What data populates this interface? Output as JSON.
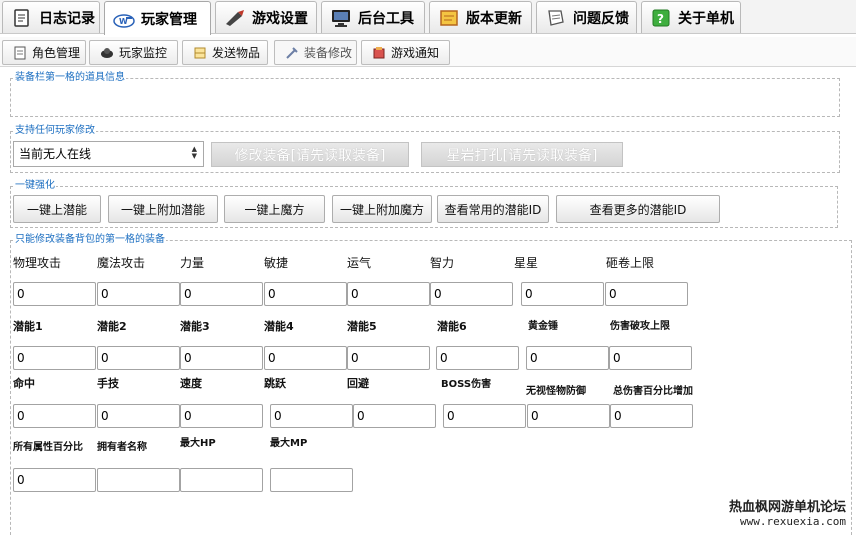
{
  "main_tabs": [
    {
      "label": "日志记录",
      "icon": "journal-icon"
    },
    {
      "label": "玩家管理",
      "icon": "user-manage-icon"
    },
    {
      "label": "游戏设置",
      "icon": "game-settings-icon"
    },
    {
      "label": "后台工具",
      "icon": "monitor-icon"
    },
    {
      "label": "版本更新",
      "icon": "scroll-icon"
    },
    {
      "label": "问题反馈",
      "icon": "feedback-icon"
    },
    {
      "label": "关于单机",
      "icon": "help-icon"
    }
  ],
  "sub_tabs": [
    {
      "label": "角色管理",
      "icon": "character-icon"
    },
    {
      "label": "玩家监控",
      "icon": "monitor-icon"
    },
    {
      "label": "发送物品",
      "icon": "send-item-icon"
    },
    {
      "label": "装备修改",
      "icon": "equipment-icon"
    },
    {
      "label": "游戏通知",
      "icon": "notice-icon"
    }
  ],
  "active_main_tab": "玩家管理",
  "active_sub_tab": "装备修改",
  "groups": {
    "item_info": "装备栏第一格的道具信息",
    "any_player": "支持任何玩家修改",
    "one_click": "一键强化",
    "stats": "只能修改装备背包的第一格的装备"
  },
  "player_select": {
    "value": "当前无人在线"
  },
  "buttons": {
    "modify_equipment": "修改装备[请先读取装备]",
    "star_stone": "星岩打孔[请先读取装备]",
    "one_click_potential": "一键上潜能",
    "one_click_extra_potential": "一键上附加潜能",
    "one_click_scroll": "一键上魔方",
    "one_click_extra_scroll": "一键上附加魔方",
    "view_common_ids": "查看常用的潜能ID",
    "view_more_ids": "查看更多的潜能ID"
  },
  "stats": {
    "row1": [
      {
        "label": "物理攻击",
        "value": "0"
      },
      {
        "label": "魔法攻击",
        "value": "0"
      },
      {
        "label": "力量",
        "value": "0"
      },
      {
        "label": "敏捷",
        "value": "0"
      },
      {
        "label": "运气",
        "value": "0"
      },
      {
        "label": "智力",
        "value": "0"
      },
      {
        "label": "星星",
        "value": "0"
      },
      {
        "label": "砸卷上限",
        "value": "0"
      }
    ],
    "row2": [
      {
        "label": "潜能1",
        "value": "0"
      },
      {
        "label": "潜能2",
        "value": "0"
      },
      {
        "label": "潜能3",
        "value": "0"
      },
      {
        "label": "潜能4",
        "value": "0"
      },
      {
        "label": "潜能5",
        "value": "0"
      },
      {
        "label": "潜能6",
        "value": "0"
      },
      {
        "label": "黄金锤",
        "value": "0"
      },
      {
        "label": "伤害破攻上限",
        "value": "0"
      }
    ],
    "row3": [
      {
        "label": "命中",
        "value": "0"
      },
      {
        "label": "手技",
        "value": "0"
      },
      {
        "label": "速度",
        "value": "0"
      },
      {
        "label": "跳跃",
        "value": "0"
      },
      {
        "label": "回避",
        "value": "0"
      },
      {
        "label": "BOSS伤害",
        "value": "0"
      },
      {
        "label": "无视怪物防御",
        "value": "0"
      },
      {
        "label": "总伤害百分比增加",
        "value": "0"
      }
    ],
    "row4": [
      {
        "label": "所有属性百分比",
        "value": "0"
      },
      {
        "label": "拥有者名称",
        "value": ""
      },
      {
        "label": "最大HP",
        "value": ""
      },
      {
        "label": "最大MP",
        "value": ""
      }
    ]
  },
  "watermark": {
    "line1": "热血枫网游单机论坛",
    "line2": "www.rexuexia.com"
  }
}
